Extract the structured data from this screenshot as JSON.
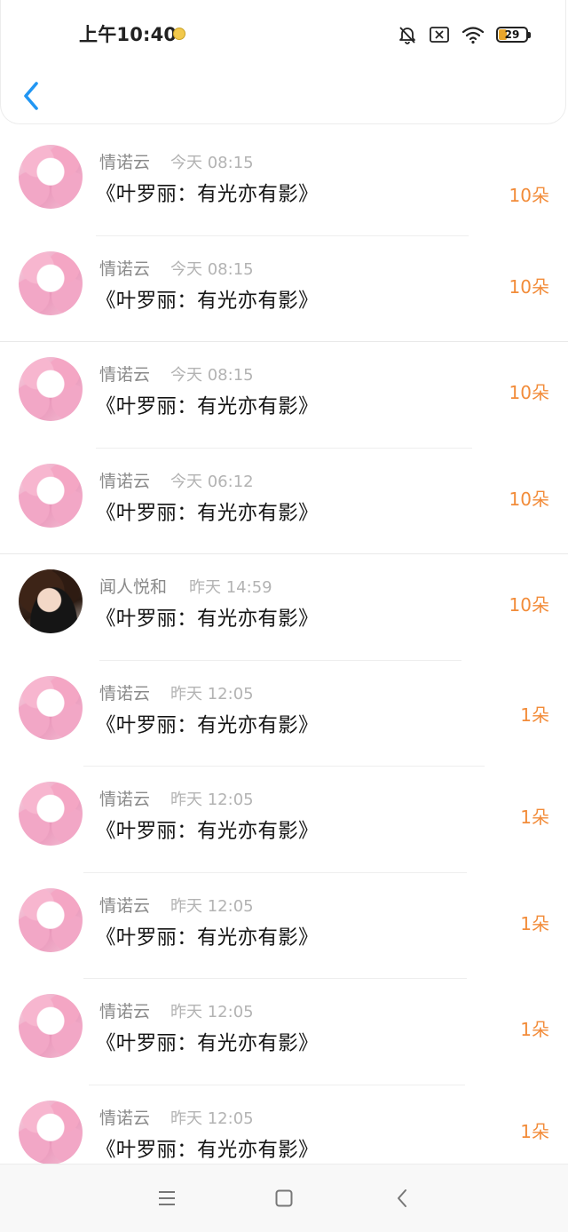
{
  "status_bar": {
    "time": "上午10:40",
    "battery": "29",
    "icons": [
      "emoji-notification-icon",
      "mute-icon",
      "sim-off-icon",
      "wifi-icon",
      "battery-icon"
    ]
  },
  "header": {
    "back_icon": "chevron-left-icon"
  },
  "colors": {
    "accent": "#2196f3",
    "amount": "#f28c3a",
    "name": "#8a8a8a",
    "time": "#b3b3b3"
  },
  "gifts": [
    {
      "user": "情诺云",
      "time": "今天 08:15",
      "title": "《叶罗丽：有光亦有影》",
      "amount": "10朵",
      "avatar": "pink"
    },
    {
      "user": "情诺云",
      "time": "今天 08:15",
      "title": "《叶罗丽：有光亦有影》",
      "amount": "10朵",
      "avatar": "pink"
    },
    {
      "user": "情诺云",
      "time": "今天 08:15",
      "title": "《叶罗丽：有光亦有影》",
      "amount": "10朵",
      "avatar": "pink"
    },
    {
      "user": "情诺云",
      "time": "今天 06:12",
      "title": "《叶罗丽：有光亦有影》",
      "amount": "10朵",
      "avatar": "pink"
    },
    {
      "user": "闻人悦和",
      "time": "昨天 14:59",
      "title": "《叶罗丽：有光亦有影》",
      "amount": "10朵",
      "avatar": "dark"
    },
    {
      "user": "情诺云",
      "time": "昨天 12:05",
      "title": "《叶罗丽：有光亦有影》",
      "amount": "1朵",
      "avatar": "pink"
    },
    {
      "user": "情诺云",
      "time": "昨天 12:05",
      "title": "《叶罗丽：有光亦有影》",
      "amount": "1朵",
      "avatar": "pink"
    },
    {
      "user": "情诺云",
      "time": "昨天 12:05",
      "title": "《叶罗丽：有光亦有影》",
      "amount": "1朵",
      "avatar": "pink"
    },
    {
      "user": "情诺云",
      "time": "昨天 12:05",
      "title": "《叶罗丽：有光亦有影》",
      "amount": "1朵",
      "avatar": "pink"
    },
    {
      "user": "情诺云",
      "time": "昨天 12:05",
      "title": "《叶罗丽：有光亦有影》",
      "amount": "1朵",
      "avatar": "pink"
    }
  ],
  "nav_bar": {
    "icons": [
      "menu-icon",
      "home-icon",
      "back-icon"
    ]
  }
}
